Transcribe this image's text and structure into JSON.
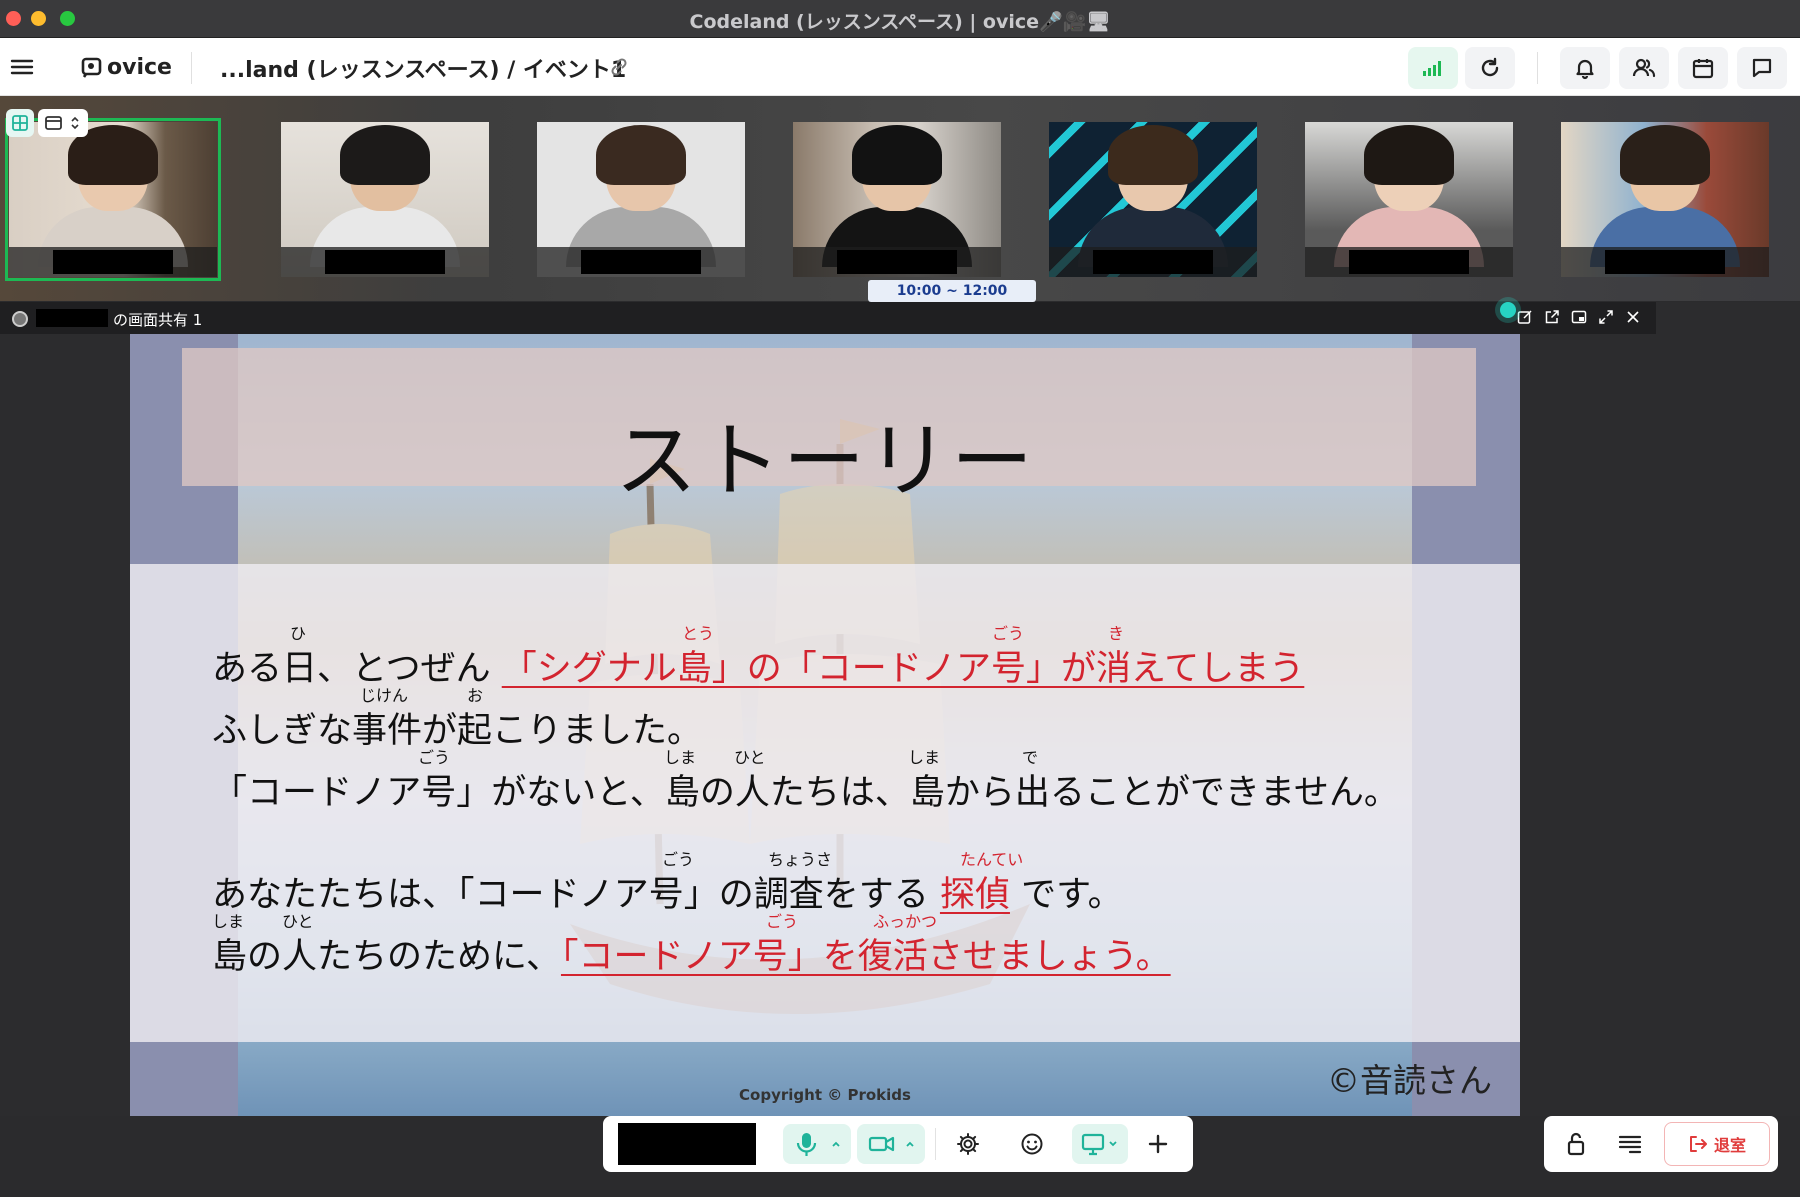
{
  "window": {
    "title": "Codeland (レッスンスペース) | ovice🎤🎥🖥"
  },
  "header": {
    "logo_text": "ovice",
    "breadcrumb": "...land (レッスンスペース) / イベント1"
  },
  "strip": {
    "schedule_time": "10:00 ~ 12:00"
  },
  "share": {
    "title": "の画面共有 1"
  },
  "slide": {
    "title": "ストーリー",
    "lines": [
      {
        "pre": "ある日、とつぜん ",
        "highlight": "「シグナル島」の「コードノア号」が消えてしまう",
        "post": ""
      },
      {
        "pre": "ふしぎな事件が起こりました。",
        "highlight": "",
        "post": ""
      },
      {
        "pre": "「コードノア号」がないと、島の人たちは、島から出ることができません。",
        "highlight": "",
        "post": ""
      },
      {
        "pre": "あなたたちは、「コードノア号」の調査をする ",
        "highlight": "探偵",
        "post": " です。"
      },
      {
        "pre": "島の人たちのために、",
        "highlight": "「コードノア号」を復活させましょう。",
        "post": ""
      }
    ],
    "ruby": {
      "hi": "ひ",
      "tou": "とう",
      "gou1": "ごう",
      "ki": "き",
      "jiken": "じけん",
      "o": "お",
      "gou2": "ごう",
      "shima1": "しま",
      "hito1": "ひと",
      "shima2": "しま",
      "de": "で",
      "gou3": "ごう",
      "chousa": "ちょうさ",
      "tantei": "たんてい",
      "shima3": "しま",
      "hito2": "ひと",
      "gou4": "ごう",
      "fukkatsu": "ふっかつ"
    },
    "copyright": "Copyright © Prokids",
    "credit": "©音読さん"
  },
  "toolbar": {
    "exit_label": "退室"
  },
  "colors": {
    "accent_green": "#1db954",
    "teal": "#1fb39a",
    "highlight_red": "#d3242f",
    "exit_red": "#e03c3c"
  },
  "icons": [
    "menu-icon",
    "link-icon",
    "signal-icon",
    "refresh-icon",
    "bell-icon",
    "people-icon",
    "calendar-icon",
    "chat-icon",
    "grid-icon",
    "layout-icon",
    "mic-icon",
    "camera-icon",
    "gear-icon",
    "emoji-icon",
    "screen-share-icon",
    "plus-icon",
    "lock-icon",
    "list-icon",
    "exit-icon"
  ]
}
